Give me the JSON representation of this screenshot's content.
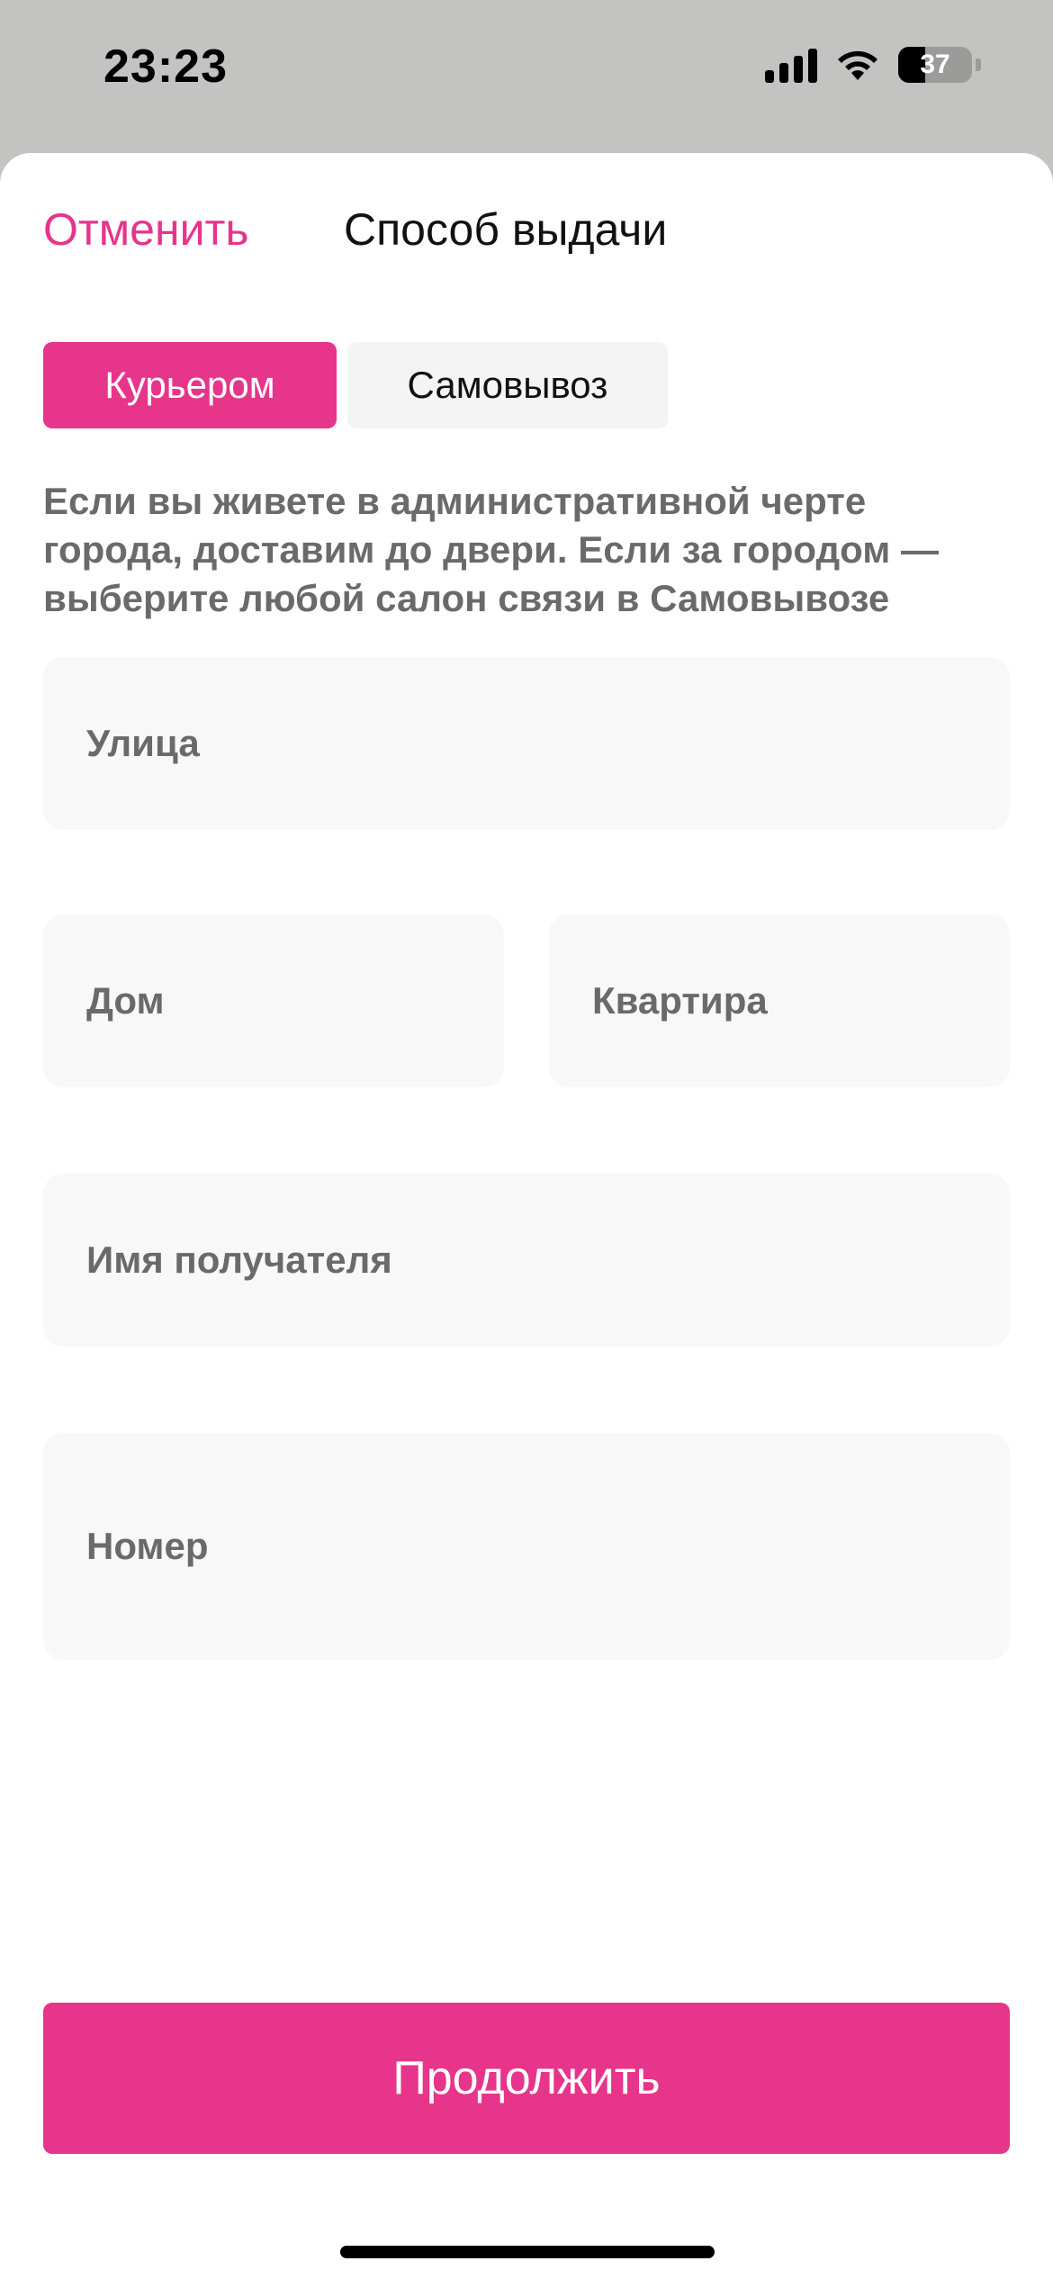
{
  "status_bar": {
    "time": "23:23",
    "battery_level": "37",
    "icons": [
      "signal-icon",
      "wifi-icon",
      "battery-icon"
    ]
  },
  "header": {
    "cancel_label": "Отменить",
    "title": "Способ выдачи"
  },
  "tabs": [
    {
      "label": "Курьером",
      "active": true
    },
    {
      "label": "Самовывоз",
      "active": false
    }
  ],
  "info_text": "Если вы живете в административной черте города, доставим до двери. Если за городом — выберите любой салон связи в Самовывозе",
  "form": {
    "street_placeholder": "Улица",
    "house_placeholder": "Дом",
    "apartment_placeholder": "Квартира",
    "recipient_placeholder": "Имя получателя",
    "phone_placeholder": "Номер"
  },
  "continue_label": "Продолжить",
  "colors": {
    "accent": "#e6358b",
    "field_bg": "#f8f8f8",
    "text_muted": "#6a6a6a"
  }
}
